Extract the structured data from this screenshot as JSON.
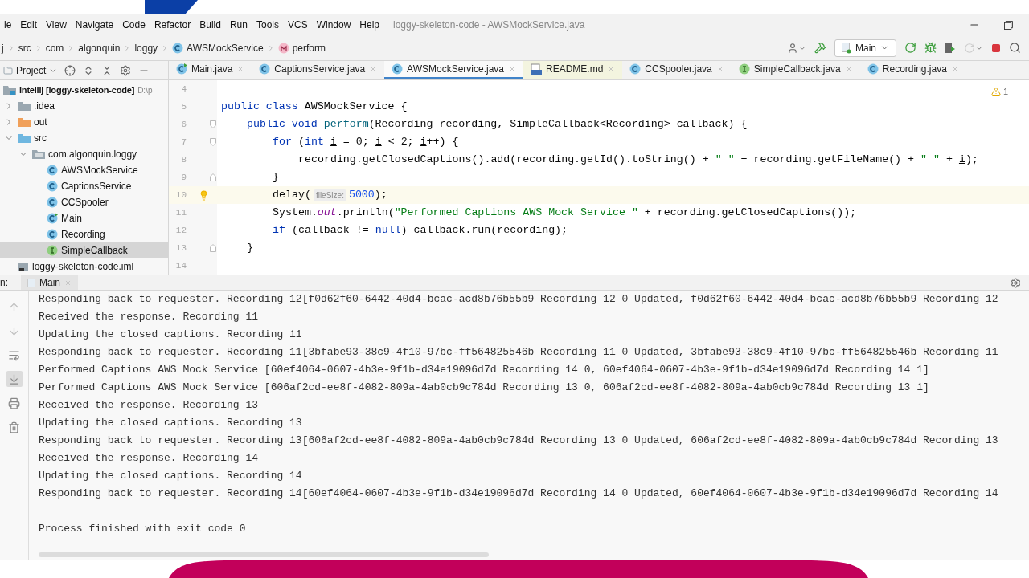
{
  "window": {
    "title": "loggy-skeleton-code - AWSMockService.java"
  },
  "menu": [
    "le",
    "Edit",
    "View",
    "Navigate",
    "Code",
    "Refactor",
    "Build",
    "Run",
    "Tools",
    "VCS",
    "Window",
    "Help"
  ],
  "breadcrumbs": [
    {
      "label": "j",
      "kind": "plain"
    },
    {
      "label": "src",
      "kind": "plain"
    },
    {
      "label": "com",
      "kind": "plain"
    },
    {
      "label": "algonquin",
      "kind": "plain"
    },
    {
      "label": "loggy",
      "kind": "plain"
    },
    {
      "label": "AWSMockService",
      "kind": "class"
    },
    {
      "label": "perform",
      "kind": "method"
    }
  ],
  "run_config": {
    "label": "Main"
  },
  "project_panel": {
    "label": "Project",
    "tree": [
      {
        "label": "intellij [loggy-skeleton-code]",
        "path": "D:\\p",
        "kind": "project",
        "selected": false,
        "children": [
          {
            "label": ".idea",
            "kind": "folder",
            "expanded": false,
            "selected": false
          },
          {
            "label": "out",
            "kind": "excluded-folder",
            "expanded": false,
            "selected": false
          },
          {
            "label": "src",
            "kind": "source-folder",
            "expanded": true,
            "selected": false,
            "children": [
              {
                "label": "com.algonquin.loggy",
                "kind": "package",
                "expanded": true,
                "selected": false,
                "children": [
                  {
                    "label": "AWSMockService",
                    "kind": "class",
                    "selected": false
                  },
                  {
                    "label": "CaptionsService",
                    "kind": "class",
                    "selected": false
                  },
                  {
                    "label": "CCSpooler",
                    "kind": "class",
                    "selected": false
                  },
                  {
                    "label": "Main",
                    "kind": "main",
                    "selected": false
                  },
                  {
                    "label": "Recording",
                    "kind": "class",
                    "selected": false
                  },
                  {
                    "label": "SimpleCallback",
                    "kind": "interface",
                    "selected": true
                  }
                ]
              }
            ]
          },
          {
            "label": "loggy-skeleton-code.iml",
            "kind": "iml",
            "selected": false
          }
        ]
      }
    ]
  },
  "editor_tabs": [
    {
      "label": "Main.java",
      "kind": "main",
      "selected": false
    },
    {
      "label": "CaptionsService.java",
      "kind": "class",
      "selected": false
    },
    {
      "label": "AWSMockService.java",
      "kind": "class",
      "selected": true
    },
    {
      "label": "README.md",
      "kind": "md",
      "selected": false
    },
    {
      "label": "CCSpooler.java",
      "kind": "class",
      "selected": false
    },
    {
      "label": "SimpleCallback.java",
      "kind": "interface",
      "selected": false
    },
    {
      "label": "Recording.java",
      "kind": "class",
      "selected": false
    }
  ],
  "editor": {
    "warnings": "1",
    "lines": [
      {
        "number": "4",
        "current": false,
        "bulb": false
      },
      {
        "number": "5",
        "current": false,
        "bulb": false,
        "tokens": [
          {
            "kind": "kw",
            "text": "public class"
          },
          {
            "kind": "plain",
            "text": " AWSMockService {"
          }
        ],
        "children": [
          {
            "number": "6",
            "kind": "fold-start",
            "current": false,
            "bulb": false,
            "tokens": [
              {
                "kind": "kw",
                "text": "public void "
              },
              {
                "kind": "method",
                "text": "perform"
              },
              {
                "kind": "plain",
                "text": "(Recording recording, SimpleCallback<Recording> callback) {"
              }
            ],
            "children": [
              {
                "number": "7",
                "kind": "fold-start",
                "current": false,
                "bulb": false,
                "tokens": [
                  {
                    "kind": "kw",
                    "text": "for"
                  },
                  {
                    "kind": "plain",
                    "text": " ("
                  },
                  {
                    "kind": "kw",
                    "text": "int "
                  },
                  {
                    "kind": "var",
                    "text": "i"
                  },
                  {
                    "kind": "plain",
                    "text": " = 0; "
                  },
                  {
                    "kind": "var",
                    "text": "i"
                  },
                  {
                    "kind": "plain",
                    "text": " < 2; "
                  },
                  {
                    "kind": "var",
                    "text": "i"
                  },
                  {
                    "kind": "plain",
                    "text": "++) {"
                  }
                ],
                "children": [
                  {
                    "number": "8",
                    "current": false,
                    "bulb": false,
                    "tokens": [
                      {
                        "kind": "plain",
                        "text": "recording.getClosedCaptions().add(recording.getId().toString() + "
                      },
                      {
                        "kind": "str",
                        "text": "\" \""
                      },
                      {
                        "kind": "plain",
                        "text": " + recording.getFileName() + "
                      },
                      {
                        "kind": "str",
                        "text": "\" \""
                      },
                      {
                        "kind": "plain",
                        "text": " + "
                      },
                      {
                        "kind": "var",
                        "text": "i"
                      },
                      {
                        "kind": "plain",
                        "text": ");"
                      }
                    ]
                  }
                ]
              },
              {
                "number": "9",
                "kind": "fold-end",
                "current": false,
                "bulb": false,
                "tokens": [
                  {
                    "kind": "plain",
                    "text": "}"
                  }
                ]
              },
              {
                "number": "10",
                "current": true,
                "bulb": true,
                "tokens": [
                  {
                    "kind": "plain",
                    "text": "delay("
                  },
                  {
                    "kind": "hint",
                    "text": "fileSize:"
                  },
                  {
                    "kind": "num",
                    "text": "5000"
                  },
                  {
                    "kind": "plain",
                    "text": ");"
                  }
                ]
              },
              {
                "number": "11",
                "current": false,
                "bulb": false,
                "tokens": [
                  {
                    "kind": "plain",
                    "text": "System."
                  },
                  {
                    "kind": "field",
                    "text": "out"
                  },
                  {
                    "kind": "plain",
                    "text": ".println("
                  },
                  {
                    "kind": "str",
                    "text": "\"Performed Captions AWS Mock Service \""
                  },
                  {
                    "kind": "plain",
                    "text": " + recording.getClosedCaptions());"
                  }
                ]
              },
              {
                "number": "12",
                "current": false,
                "bulb": false,
                "tokens": [
                  {
                    "kind": "kw",
                    "text": "if"
                  },
                  {
                    "kind": "plain",
                    "text": " (callback != "
                  },
                  {
                    "kind": "kw",
                    "text": "null"
                  },
                  {
                    "kind": "plain",
                    "text": ") callback.run(recording);"
                  }
                ]
              }
            ]
          },
          {
            "number": "13",
            "kind": "fold-end",
            "current": false,
            "bulb": false,
            "tokens": [
              {
                "kind": "plain",
                "text": "}"
              }
            ]
          }
        ]
      },
      {
        "number": "14",
        "current": false,
        "bulb": false
      }
    ]
  },
  "run_panel": {
    "label": "n:",
    "tabs": [
      {
        "label": "Main",
        "selected": true
      }
    ],
    "tools": [
      {
        "kind": "up",
        "on": false
      },
      {
        "kind": "down",
        "on": false
      },
      {
        "kind": "wrap",
        "on": false
      },
      {
        "kind": "scroll-end",
        "on": true
      },
      {
        "kind": "print",
        "on": false
      },
      {
        "kind": "trash",
        "on": false
      }
    ],
    "console": [
      "Responding back to requester. Recording 12[f0d62f60-6442-40d4-bcac-acd8b76b55b9 Recording 12 0 Updated, f0d62f60-6442-40d4-bcac-acd8b76b55b9 Recording 12",
      "Received the response. Recording 11",
      "Updating the closed captions. Recording 11",
      "Responding back to requester. Recording 11[3bfabe93-38c9-4f10-97bc-ff564825546b Recording 11 0 Updated, 3bfabe93-38c9-4f10-97bc-ff564825546b Recording 11",
      "Performed Captions AWS Mock Service [60ef4064-0607-4b3e-9f1b-d34e19096d7d Recording 14 0, 60ef4064-0607-4b3e-9f1b-d34e19096d7d Recording 14 1]",
      "Performed Captions AWS Mock Service [606af2cd-ee8f-4082-809a-4ab0cb9c784d Recording 13 0, 606af2cd-ee8f-4082-809a-4ab0cb9c784d Recording 13 1]",
      "Received the response. Recording 13",
      "Updating the closed captions. Recording 13",
      "Responding back to requester. Recording 13[606af2cd-ee8f-4082-809a-4ab0cb9c784d Recording 13 0 Updated, 606af2cd-ee8f-4082-809a-4ab0cb9c784d Recording 13",
      "Received the response. Recording 14",
      "Updating the closed captions. Recording 14",
      "Responding back to requester. Recording 14[60ef4064-0607-4b3e-9f1b-d34e19096d7d Recording 14 0 Updated, 60ef4064-0607-4b3e-9f1b-d34e19096d7d Recording 14"
    ],
    "exit_message": "Process finished with exit code 0"
  }
}
